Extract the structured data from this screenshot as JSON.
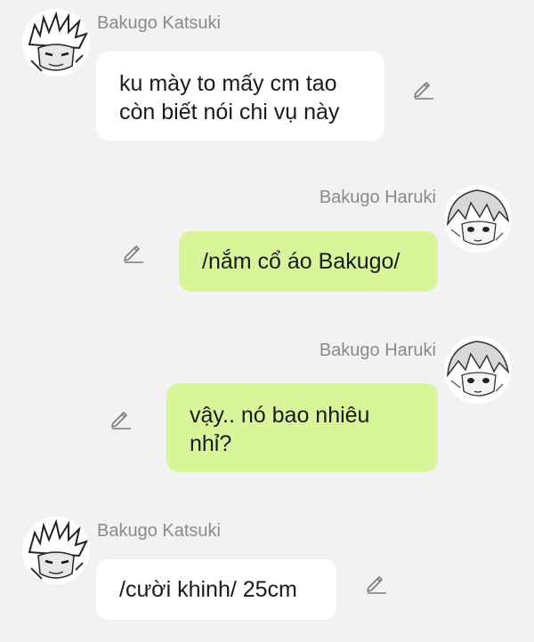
{
  "messages": [
    {
      "sender": "Bakugo Katsuki",
      "avatar_icon": "spiky-hair-avatar",
      "text": "ku mày to mấy cm tao còn biết nói chi vụ này",
      "side": "left",
      "bubble_color": "#ffffff"
    },
    {
      "sender": "Bakugo Haruki",
      "avatar_icon": "soft-hair-avatar",
      "text": "/nắm cổ áo Bakugo/",
      "side": "right",
      "bubble_color": "#d8f59a"
    },
    {
      "sender": "Bakugo Haruki",
      "avatar_icon": "soft-hair-avatar",
      "text": "vậy.. nó bao nhiêu nhỉ?",
      "side": "right",
      "bubble_color": "#d8f59a"
    },
    {
      "sender": "Bakugo Katsuki",
      "avatar_icon": "spiky-hair-avatar",
      "text": "/cười khinh/ 25cm",
      "side": "left",
      "bubble_color": "#ffffff"
    }
  ],
  "colors": {
    "background": "#f2f2f2",
    "name_text": "#8a8a8a",
    "edit_icon": "#7a7a7a"
  },
  "edit_icon": "pencil-edit-icon"
}
